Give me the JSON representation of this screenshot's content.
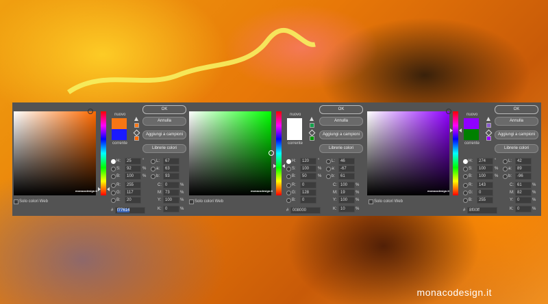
{
  "colors": {
    "panel": "#535353",
    "accent_orange": "#f77614",
    "accent_green": "#008000",
    "accent_purple": "#8f00ff"
  },
  "dialogs": [
    {
      "labels": {
        "nuovo": "nuovo",
        "corrente": "corrente"
      },
      "buttons": {
        "ok": "OK",
        "cancel": "Annulla",
        "add": "Aggiungi a campioni",
        "libs": "Librerie colori"
      },
      "web_only": "Solo colori Web",
      "watermark": "monacodesign.it",
      "hsb": [
        [
          "H:",
          "25",
          "°"
        ],
        [
          "S:",
          "92",
          "%"
        ],
        [
          "B:",
          "100",
          "%"
        ]
      ],
      "rgb": [
        [
          "R:",
          "255",
          ""
        ],
        [
          "G:",
          "117",
          ""
        ],
        [
          "B:",
          "20",
          ""
        ]
      ],
      "lab": [
        [
          "L:",
          "67"
        ],
        [
          "a:",
          "63"
        ],
        [
          "b:",
          "93"
        ]
      ],
      "cmyk": [
        [
          "C:",
          "0",
          "%"
        ],
        [
          "M:",
          "73",
          "%"
        ],
        [
          "Y:",
          "100",
          "%"
        ],
        [
          "K:",
          "0",
          "%"
        ]
      ],
      "hex_prefix": "#",
      "hex": "f77614",
      "new_color": "#f77614",
      "current_color": "#1a1aff"
    },
    {
      "labels": {
        "nuovo": "nuovo",
        "corrente": "corrente"
      },
      "buttons": {
        "ok": "OK",
        "cancel": "Annulla",
        "add": "Aggiungi a campioni",
        "libs": "Librerie colori"
      },
      "web_only": "Solo colori Web",
      "watermark": "monacodesign.it",
      "hsb": [
        [
          "H:",
          "120",
          "°"
        ],
        [
          "S:",
          "100",
          "%"
        ],
        [
          "B:",
          "50",
          "%"
        ]
      ],
      "rgb": [
        [
          "R:",
          "0",
          ""
        ],
        [
          "G:",
          "128",
          ""
        ],
        [
          "B:",
          "0",
          ""
        ]
      ],
      "lab": [
        [
          "L:",
          "46"
        ],
        [
          "a:",
          "-67"
        ],
        [
          "b:",
          "61"
        ]
      ],
      "cmyk": [
        [
          "C:",
          "100",
          "%"
        ],
        [
          "M:",
          "19",
          "%"
        ],
        [
          "Y:",
          "100",
          "%"
        ],
        [
          "K:",
          "10",
          "%"
        ]
      ],
      "hex_prefix": "#",
      "hex": "008000",
      "new_color": "#ffffff",
      "current_color": "#ffffff"
    },
    {
      "labels": {
        "nuovo": "nuovo",
        "corrente": "corrente"
      },
      "buttons": {
        "ok": "OK",
        "cancel": "Annulla",
        "add": "Aggiungi a campioni",
        "libs": "Librerie colori"
      },
      "web_only": "Solo colori Web",
      "watermark": "monacodesign.it",
      "hsb": [
        [
          "H:",
          "274",
          "°"
        ],
        [
          "S:",
          "100",
          "%"
        ],
        [
          "B:",
          "100",
          "%"
        ]
      ],
      "rgb": [
        [
          "R:",
          "143",
          ""
        ],
        [
          "G:",
          "0",
          ""
        ],
        [
          "B:",
          "255",
          ""
        ]
      ],
      "lab": [
        [
          "L:",
          "42"
        ],
        [
          "a:",
          "89"
        ],
        [
          "b:",
          "-96"
        ]
      ],
      "cmyk": [
        [
          "C:",
          "61",
          "%"
        ],
        [
          "M:",
          "82",
          "%"
        ],
        [
          "Y:",
          "0",
          "%"
        ],
        [
          "K:",
          "0",
          "%"
        ]
      ],
      "hex_prefix": "#",
      "hex": "8f00ff",
      "new_color": "#8f00ff",
      "current_color": "#008000"
    }
  ],
  "credit": "monacodesign.it"
}
